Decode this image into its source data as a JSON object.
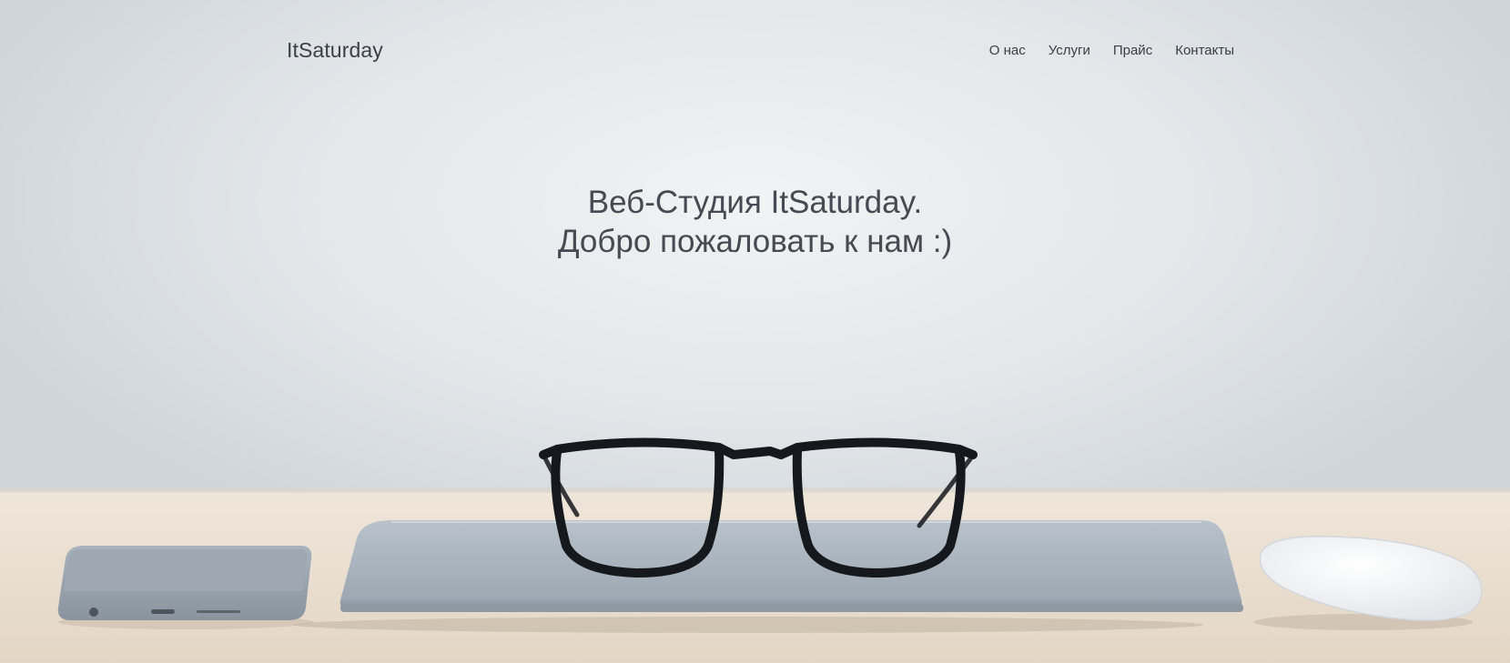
{
  "header": {
    "logo": "ItSaturday",
    "nav": [
      {
        "label": "О нас"
      },
      {
        "label": "Услуги"
      },
      {
        "label": "Прайс"
      },
      {
        "label": "Контакты"
      }
    ]
  },
  "hero": {
    "title_line1": "Веб-Студия ItSaturday.",
    "title_line2": "Добро пожаловать к нам :)",
    "image": "desk-photo-with-glasses-laptop-phone-mouse"
  },
  "colors": {
    "text": "#3b3f47",
    "wall": "#e3e7ea",
    "desk": "#eadfd2"
  }
}
